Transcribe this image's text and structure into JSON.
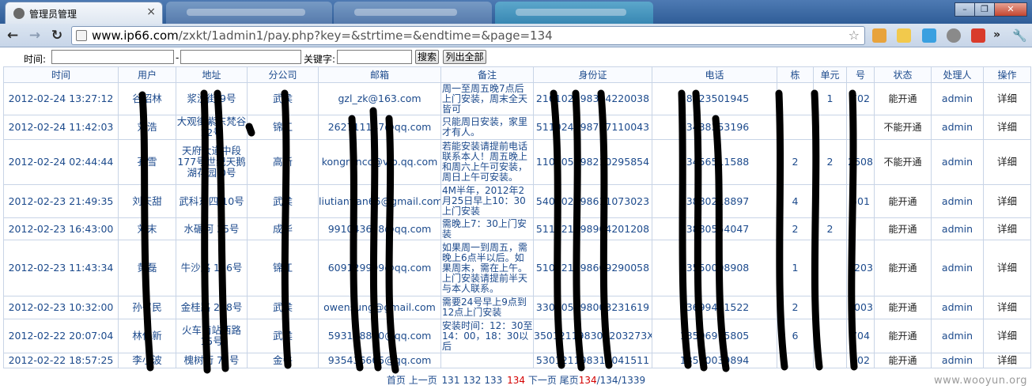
{
  "browser": {
    "active_tab_title": "管理员管理",
    "address_host": "www.ip66.com",
    "address_path": "/zxkt/1admin1/pay.php?key=&strtime=&endtime=&page=134"
  },
  "search": {
    "time_label": "时间:",
    "range_sep": "-",
    "keyword_label": "关键字:",
    "search_button": "搜索",
    "list_all_button": "列出全部"
  },
  "table": {
    "headers": [
      "时间",
      "用户",
      "地址",
      "分公司",
      "邮箱",
      "备注",
      "身份证",
      "电话",
      "栋",
      "单元",
      "号",
      "状态",
      "处理人",
      "操作"
    ],
    "rows": [
      {
        "time": "2012-02-24 13:27:12",
        "user": "谷昭林",
        "addr": "浆洗街 9号",
        "branch": "武侯",
        "email": "gzl_zk@163.com",
        "note": "周一至周五晚7点后上门安装，周末全天皆可",
        "id": "210102198304220038",
        "phone": "18123501945",
        "dong": "",
        "unit": "1",
        "num": "702",
        "status": "能开通",
        "handler": "admin",
        "op": "详细"
      },
      {
        "time": "2012-02-24 11:42:03",
        "user": "刘浩",
        "addr": "大观街紫东梵谷 12号",
        "branch": "锦江",
        "email": "262711147@qq.com",
        "note": "只能周日安装，家里才有人。",
        "id": "511024198707110043",
        "phone": "13438353196",
        "dong": "",
        "unit": "",
        "num": "",
        "status": "不能开通",
        "handler": "admin",
        "op": "详细"
      },
      {
        "time": "2012-02-24 02:44:44",
        "user": "孔雪",
        "addr": "天府大道中段177号世纪天鹅湖花园 0号",
        "branch": "高新",
        "email": "kongrancc@vip.qq.com",
        "note": "若能安装请提前电话联系本人！周五晚上和周六上午可安装，周日上午可安装。",
        "id": "110105198210295854",
        "phone": "13456511588",
        "dong": "2",
        "unit": "2",
        "num": "2608",
        "status": "不能开通",
        "handler": "admin",
        "op": "详细"
      },
      {
        "time": "2012-02-23 21:49:35",
        "user": "刘天甜",
        "addr": "武科东四 10号",
        "branch": "武侯",
        "email": "liutiantian65@gmail.com",
        "note": "4M半年，2012年2月25日早上10：30上门安装",
        "id": "540102198611073023",
        "phone": "13880218897",
        "dong": "4",
        "unit": "",
        "num": "501",
        "status": "能开通",
        "handler": "admin",
        "op": "详细"
      },
      {
        "time": "2012-02-23 16:43:00",
        "user": "刘末",
        "addr": "水碾河 35号",
        "branch": "成华",
        "email": "991043628@qq.com",
        "note": "需晚上7：30上门安装",
        "id": "511521198904201208",
        "phone": "13880554047",
        "dong": "2",
        "unit": "2",
        "num": "",
        "status": "能开通",
        "handler": "admin",
        "op": "详细"
      },
      {
        "time": "2012-02-23 11:43:34",
        "user": "黄磊",
        "addr": "牛沙路 166号",
        "branch": "锦江",
        "email": "609129999@qq.com",
        "note": "如果周一到周五，需晚上6点半以后。如果周末，需在上午。上门安装请提前半天与本人联系。",
        "id": "510321198609290058",
        "phone": "13550008908",
        "dong": "1",
        "unit": "",
        "num": "2203",
        "status": "能开通",
        "handler": "admin",
        "op": "详细"
      },
      {
        "time": "2012-02-23 10:32:00",
        "user": "孙召民",
        "addr": "金桂路 238号",
        "branch": "武侯",
        "email": "owensung@gmail.com",
        "note": "需要24号早上9点到12点上门安装",
        "id": "330105198003231619",
        "phone": "13699441522",
        "dong": "2",
        "unit": "",
        "num": "1003",
        "status": "能开通",
        "handler": "admin",
        "op": "详细"
      },
      {
        "time": "2012-02-22 20:07:04",
        "user": "林伟新",
        "addr": "火车南站西路 15号",
        "branch": "武侯",
        "email": "593128830@qq.com",
        "note": "安装时间：12：30至14：00，18：30以后",
        "id": "350121198305203273X",
        "phone": "13506915805",
        "dong": "6",
        "unit": "",
        "num": "704",
        "status": "能开通",
        "handler": "admin",
        "op": "详细"
      },
      {
        "time": "2012-02-22 18:57:25",
        "user": "李小波",
        "addr": "槐树街 75号",
        "branch": "金牛",
        "email": "935436605@qq.com",
        "note": "",
        "id": "530121198311041511",
        "phone": "13550039894",
        "dong": "",
        "unit": "",
        "num": "202",
        "status": "能开通",
        "handler": "admin",
        "op": "详细"
      }
    ]
  },
  "pager": {
    "first": "首页",
    "prev": "上一页",
    "pages": [
      "131",
      "132",
      "133"
    ],
    "current": "134",
    "next": "下一页",
    "last": "尾页",
    "position": "134",
    "slash1": "/",
    "total_a": "134",
    "slash2": "/",
    "total_b": "1339"
  },
  "watermark": "www.wooyun.org",
  "colors": {
    "link_blue": "#1c4a8c",
    "current_page_red": "#d40000",
    "grid_border": "#c8d4e6",
    "redaction": "#000000"
  }
}
